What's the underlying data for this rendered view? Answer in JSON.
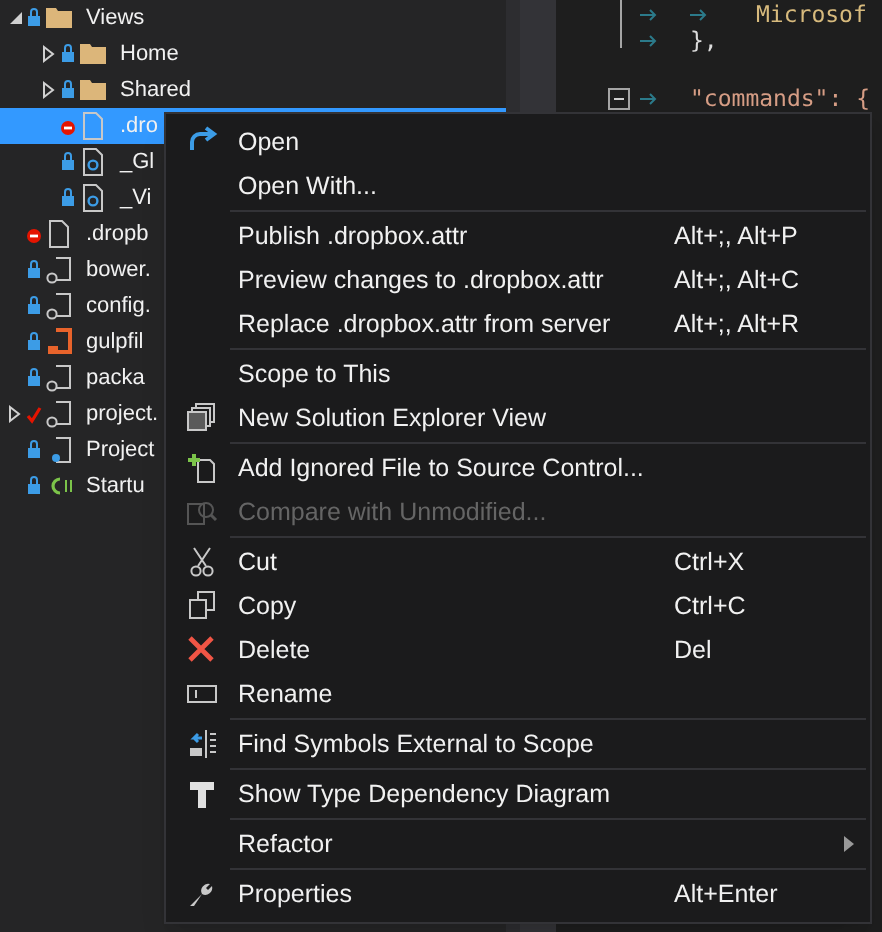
{
  "solution_explorer": {
    "items": [
      {
        "label": "Views",
        "kind": "folder",
        "locked": true,
        "excluded": false,
        "checked_out": false,
        "expanded": true,
        "selected": false,
        "children": [
          {
            "label": "Home",
            "kind": "folder",
            "locked": true,
            "excluded": false,
            "checked_out": false,
            "expanded": false,
            "selected": false
          },
          {
            "label": "Shared",
            "kind": "folder",
            "locked": true,
            "excluded": false,
            "checked_out": false,
            "expanded": false,
            "selected": false
          },
          {
            "label": ".dro",
            "kind": "file",
            "locked": false,
            "excluded": true,
            "checked_out": false,
            "selected": true
          },
          {
            "label": "_Gl",
            "kind": "razor",
            "locked": true,
            "excluded": false,
            "checked_out": false,
            "selected": false
          },
          {
            "label": "_Vi",
            "kind": "razor",
            "locked": true,
            "excluded": false,
            "checked_out": false,
            "selected": false
          }
        ]
      },
      {
        "label": ".dropb",
        "kind": "file",
        "locked": false,
        "excluded": true,
        "checked_out": false,
        "selected": false
      },
      {
        "label": "bower.",
        "kind": "json",
        "locked": true,
        "excluded": false,
        "checked_out": false,
        "selected": false
      },
      {
        "label": "config.",
        "kind": "json",
        "locked": true,
        "excluded": false,
        "checked_out": false,
        "selected": false
      },
      {
        "label": "gulpfil",
        "kind": "gulp",
        "locked": true,
        "excluded": false,
        "checked_out": false,
        "selected": false
      },
      {
        "label": "packa",
        "kind": "json",
        "locked": true,
        "excluded": false,
        "checked_out": false,
        "selected": false
      },
      {
        "label": "project.",
        "kind": "json",
        "locked": false,
        "excluded": false,
        "checked_out": true,
        "expanded": false,
        "selected": false
      },
      {
        "label": "Project",
        "kind": "project",
        "locked": true,
        "excluded": false,
        "checked_out": false,
        "selected": false
      },
      {
        "label": "Startu",
        "kind": "csharp",
        "locked": true,
        "excluded": false,
        "checked_out": false,
        "selected": false
      }
    ]
  },
  "editor": {
    "lines": [
      {
        "text": "Microsof",
        "kind": "nested",
        "collapsible": false
      },
      {
        "text": "},",
        "kind": "top",
        "collapsible": false
      },
      {
        "text": "\"commands\": {",
        "kind": "top",
        "collapsible": true
      }
    ]
  },
  "context_menu": {
    "groups": [
      [
        {
          "label": "Open",
          "kind": "open",
          "disabled": false
        },
        {
          "label": "Open With...",
          "kind": "plain",
          "disabled": false
        }
      ],
      [
        {
          "label": "Publish .dropbox.attr",
          "shortcut": "Alt+;, Alt+P",
          "kind": "plain",
          "disabled": false
        },
        {
          "label": "Preview changes to .dropbox.attr",
          "shortcut": "Alt+;, Alt+C",
          "kind": "plain",
          "disabled": false
        },
        {
          "label": "Replace .dropbox.attr from server",
          "shortcut": "Alt+;, Alt+R",
          "kind": "plain",
          "disabled": false
        }
      ],
      [
        {
          "label": "Scope to This",
          "kind": "plain",
          "disabled": false
        },
        {
          "label": "New Solution Explorer View",
          "kind": "new_view",
          "disabled": false
        }
      ],
      [
        {
          "label": "Add Ignored File to Source Control...",
          "kind": "add_file",
          "disabled": false
        },
        {
          "label": "Compare with Unmodified...",
          "kind": "compare",
          "disabled": true
        }
      ],
      [
        {
          "label": "Cut",
          "shortcut": "Ctrl+X",
          "kind": "cut",
          "disabled": false
        },
        {
          "label": "Copy",
          "shortcut": "Ctrl+C",
          "kind": "copy",
          "disabled": false
        },
        {
          "label": "Delete",
          "shortcut": "Del",
          "kind": "delete",
          "disabled": false
        },
        {
          "label": "Rename",
          "kind": "rename",
          "disabled": false
        }
      ],
      [
        {
          "label": "Find Symbols External to Scope",
          "kind": "find_symbols",
          "disabled": false
        }
      ],
      [
        {
          "label": "Show Type Dependency Diagram",
          "kind": "type_diagram",
          "disabled": false
        }
      ],
      [
        {
          "label": "Refactor",
          "kind": "plain",
          "submenu": true,
          "disabled": false
        }
      ],
      [
        {
          "label": "Properties",
          "shortcut": "Alt+Enter",
          "kind": "properties",
          "disabled": false
        }
      ]
    ]
  }
}
